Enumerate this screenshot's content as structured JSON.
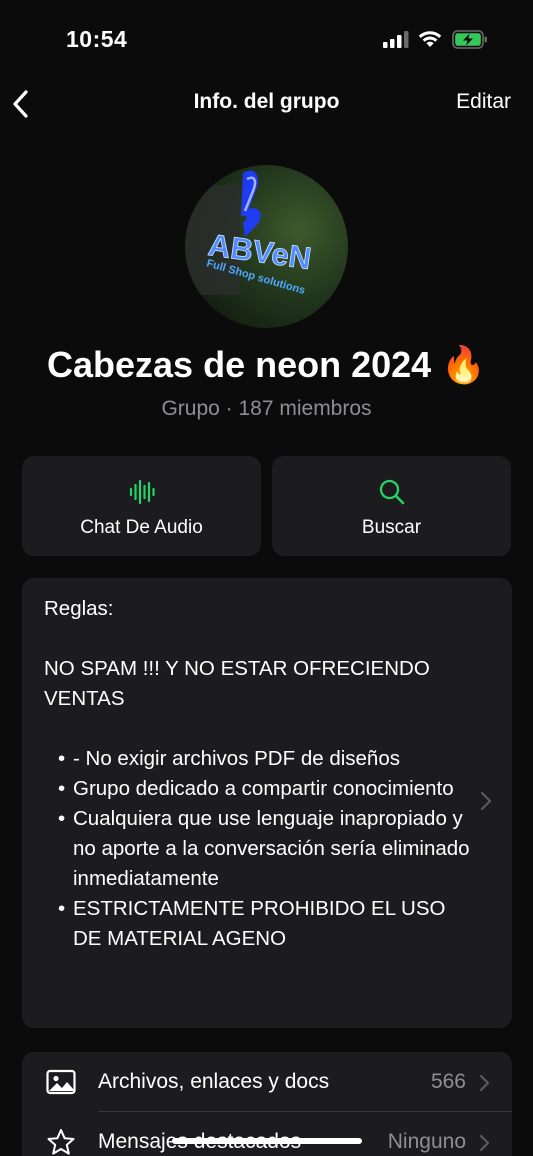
{
  "status_bar": {
    "time": "10:54"
  },
  "nav": {
    "title": "Info. del grupo",
    "edit_label": "Editar"
  },
  "group": {
    "name": "Cabezas de neon 2024 🔥",
    "subtitle": "Grupo · 187 miembros",
    "avatar_text": "ABVeN",
    "avatar_subtext": "Full Shop solutions"
  },
  "actions": [
    {
      "label": "Chat De Audio",
      "icon": "audio-wave-icon"
    },
    {
      "label": "Buscar",
      "icon": "search-icon"
    }
  ],
  "description": {
    "heading": "Reglas:",
    "intro": "NO SPAM !!! Y NO ESTAR OFRECIENDO VENTAS",
    "bullets": [
      "- No exigir archivos PDF de diseños",
      "Grupo dedicado a compartir conocimiento",
      "Cualquiera que use lenguaje inapropiado y no aporte a la conversación sería eliminado inmediatamente",
      "ESTRICTAMENTE PROHIBIDO EL USO DE MATERIAL AGENO"
    ]
  },
  "list": [
    {
      "label": "Archivos, enlaces y docs",
      "value": "566",
      "icon": "photo-icon"
    },
    {
      "label": "Mensajes destacados",
      "value": "Ninguno",
      "icon": "star-icon"
    }
  ],
  "colors": {
    "accent": "#25d366",
    "background": "#0b0b0b",
    "card": "#1c1c1e",
    "secondary_text": "#8e8e93"
  }
}
